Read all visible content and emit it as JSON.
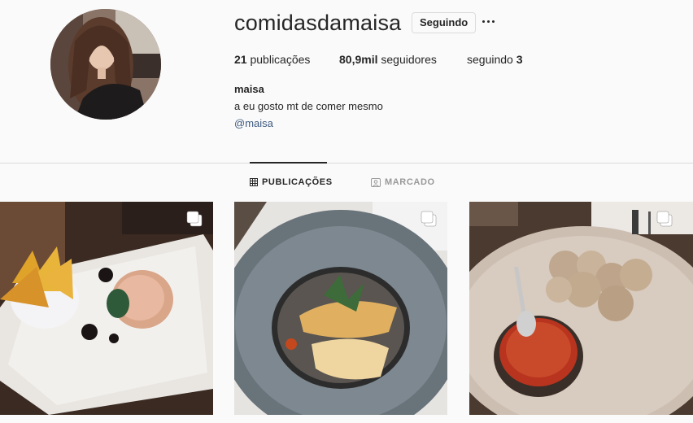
{
  "profile": {
    "username": "comidasdamaisa",
    "follow_label": "Seguindo",
    "posts_count": "21",
    "posts_label": "publicações",
    "followers_count": "80,9mil",
    "followers_label": "seguidores",
    "following_label": "seguindo",
    "following_count": "3",
    "full_name": "maisa",
    "bio": "a eu gosto mt de comer mesmo",
    "bio_link": "@maisa"
  },
  "tabs": [
    {
      "label": "PUBLICAÇÕES",
      "icon": "grid-icon",
      "active": true
    },
    {
      "label": "MARCADO",
      "icon": "tag-icon",
      "active": false
    }
  ],
  "posts": [
    {
      "description_icon": "carousel-icon"
    },
    {
      "description_icon": "carousel-icon"
    },
    {
      "description_icon": "carousel-icon"
    }
  ],
  "colors": {
    "text": "#262626",
    "muted": "#999999",
    "link": "#3d5a80",
    "border": "#dbdbdb",
    "background": "#fafafa"
  }
}
